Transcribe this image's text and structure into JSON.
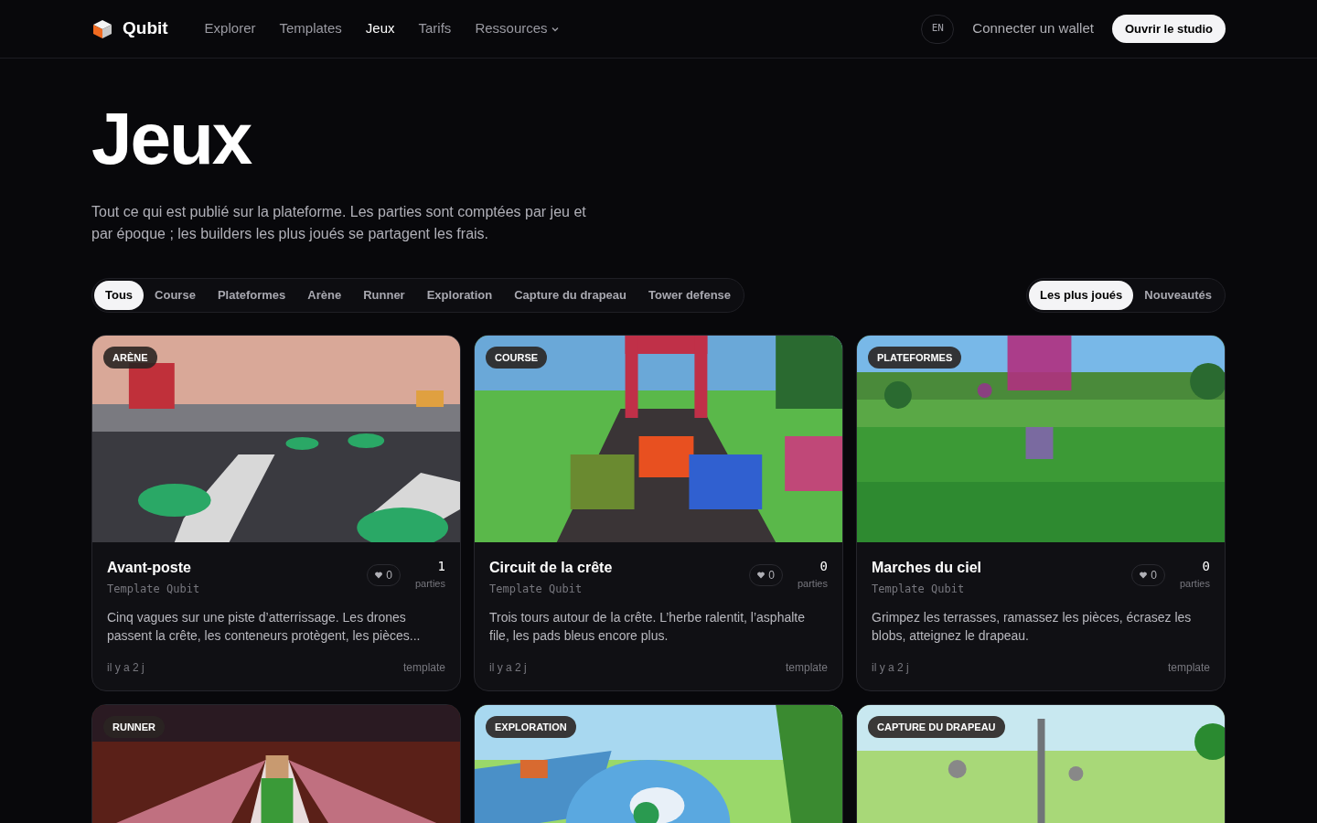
{
  "brand": "Qubit",
  "nav": [
    {
      "label": "Explorer",
      "selected": false
    },
    {
      "label": "Templates",
      "selected": false
    },
    {
      "label": "Jeux",
      "selected": true
    },
    {
      "label": "Tarifs",
      "selected": false
    },
    {
      "label": "Ressources",
      "selected": false,
      "dropdown": true
    }
  ],
  "language": "EN",
  "wallet_link": "Connecter un wallet",
  "studio_button": "Ouvrir le studio",
  "title": "Jeux",
  "intro": "Tout ce qui est publié sur la plateforme. Les parties sont comptées par jeu et par époque ; les builders les plus joués se partagent les frais.",
  "filters": [
    {
      "label": "Tous",
      "selected": true
    },
    {
      "label": "Course",
      "selected": false
    },
    {
      "label": "Plateformes",
      "selected": false
    },
    {
      "label": "Arène",
      "selected": false
    },
    {
      "label": "Runner",
      "selected": false
    },
    {
      "label": "Exploration",
      "selected": false
    },
    {
      "label": "Capture du drapeau",
      "selected": false
    },
    {
      "label": "Tower defense",
      "selected": false
    }
  ],
  "sort": [
    {
      "label": "Les plus joués",
      "selected": true
    },
    {
      "label": "Nouveautés",
      "selected": false
    }
  ],
  "games": [
    {
      "tag": "ARÈNE",
      "title": "Avant-poste",
      "author": "Template Qubit",
      "likes": "0",
      "plays": "1",
      "plays_label": "parties",
      "description": "Cinq vagues sur une piste d’atterrissage. Les drones passent la crête, les conteneurs protègent, les pièces...",
      "age": "il y a 2 j",
      "type": "template"
    },
    {
      "tag": "COURSE",
      "title": "Circuit de la crête",
      "author": "Template Qubit",
      "likes": "0",
      "plays": "0",
      "plays_label": "parties",
      "description": "Trois tours autour de la crête. L’herbe ralentit, l’asphalte file, les pads bleus encore plus.",
      "age": "il y a 2 j",
      "type": "template"
    },
    {
      "tag": "PLATEFORMES",
      "title": "Marches du ciel",
      "author": "Template Qubit",
      "likes": "0",
      "plays": "0",
      "plays_label": "parties",
      "description": "Grimpez les terrasses, ramassez les pièces, écrasez les blobs, atteignez le drapeau.",
      "age": "il y a 2 j",
      "type": "template"
    },
    {
      "tag": "RUNNER"
    },
    {
      "tag": "EXPLORATION"
    },
    {
      "tag": "CAPTURE DU DRAPEAU"
    }
  ]
}
